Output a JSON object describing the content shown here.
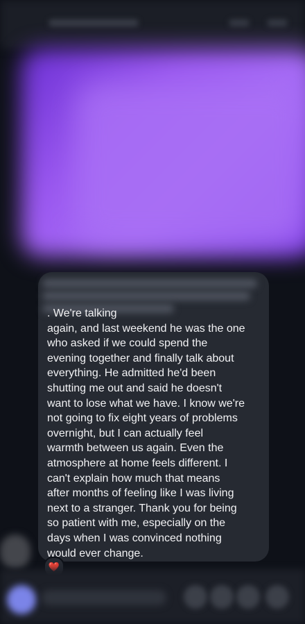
{
  "message": {
    "visible_text": ". We're talking\nagain, and last weekend he was the one\nwho asked if we could spend the\nevening together and finally talk about\neverything. He admitted he'd been\nshutting me out and said he doesn't\nwant to lose what we have. I know we're\nnot going to fix eight years of problems\novernight, but I can actually feel\nwarmth between us again. Even the\natmosphere at home feels different. I\ncan't explain how much that means\nafter months of feeling like I was living\nnext to a stranger. Thank you for being\nso patient with me, especially on the\ndays when I was convinced nothing\nwould ever change.",
    "reaction": "❤️"
  },
  "colors": {
    "background": "#0e1118",
    "bubble": "#262a32",
    "text": "#f2f2f4",
    "image_preview": "#9b59f0",
    "composer_avatar": "#7b84e8"
  },
  "icons": [
    "heart-reaction-icon",
    "contact-avatar",
    "composer-avatar"
  ]
}
